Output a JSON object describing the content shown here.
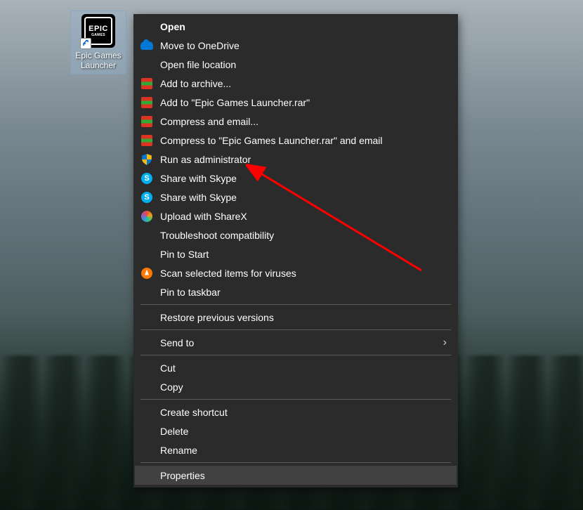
{
  "desktop": {
    "icon_label": "Epic Games Launcher",
    "logo_text": "EPIC",
    "logo_subtext": "GAMES"
  },
  "context_menu": {
    "groups": [
      [
        {
          "label": "Open",
          "bold": true,
          "icon": null
        },
        {
          "label": "Move to OneDrive",
          "icon": "onedrive"
        },
        {
          "label": "Open file location",
          "icon": null
        },
        {
          "label": "Add to archive...",
          "icon": "winrar"
        },
        {
          "label": "Add to \"Epic Games Launcher.rar\"",
          "icon": "winrar"
        },
        {
          "label": "Compress and email...",
          "icon": "winrar"
        },
        {
          "label": "Compress to \"Epic Games Launcher.rar\" and email",
          "icon": "winrar"
        },
        {
          "label": "Run as administrator",
          "icon": "shield"
        },
        {
          "label": "Share with Skype",
          "icon": "skype"
        },
        {
          "label": "Share with Skype",
          "icon": "skype"
        },
        {
          "label": "Upload with ShareX",
          "icon": "sharex"
        },
        {
          "label": "Troubleshoot compatibility",
          "icon": null
        },
        {
          "label": "Pin to Start",
          "icon": null
        },
        {
          "label": "Scan selected items for viruses",
          "icon": "avast"
        },
        {
          "label": "Pin to taskbar",
          "icon": null
        }
      ],
      [
        {
          "label": "Restore previous versions",
          "icon": null
        }
      ],
      [
        {
          "label": "Send to",
          "icon": null,
          "submenu": true
        }
      ],
      [
        {
          "label": "Cut",
          "icon": null
        },
        {
          "label": "Copy",
          "icon": null
        }
      ],
      [
        {
          "label": "Create shortcut",
          "icon": null
        },
        {
          "label": "Delete",
          "icon": null
        },
        {
          "label": "Rename",
          "icon": null
        }
      ],
      [
        {
          "label": "Properties",
          "icon": null,
          "highlighted": true
        }
      ]
    ]
  },
  "annotation": {
    "color": "#ff0000",
    "target": "Run as administrator"
  }
}
